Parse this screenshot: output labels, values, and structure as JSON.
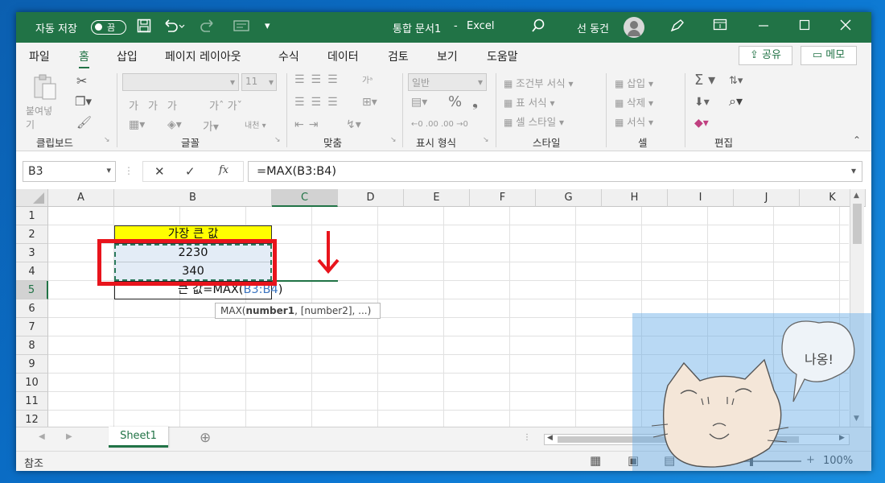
{
  "titlebar": {
    "autosave_label": "자동 저장",
    "toggle_state": "끔",
    "doc_title": "통합 문서1",
    "separator": "-",
    "app_name": "Excel",
    "user_name": "선 동건"
  },
  "menu": {
    "file": "파일",
    "home": "홈",
    "insert": "삽입",
    "page_layout": "페이지 레이아웃",
    "formulas": "수식",
    "data": "데이터",
    "review": "검토",
    "view": "보기",
    "help": "도움말",
    "share": "공유",
    "comments": "메모"
  },
  "ribbon": {
    "clipboard": "클립보드",
    "paste": "붙여넣기",
    "font": "글꼴",
    "font_size": "11",
    "alignment": "맞춤",
    "number": "표시 형식",
    "number_format": "일반",
    "styles": "스타일",
    "conditional_format": "조건부 서식",
    "format_as_table": "표 서식",
    "cell_styles": "셀 스타일",
    "cells": "셀",
    "insert": "삽입",
    "delete": "삭제",
    "format": "서식",
    "editing": "편집"
  },
  "formula_bar": {
    "name_box": "B3",
    "formula": "=MAX(B3:B4)"
  },
  "grid": {
    "columns": [
      "A",
      "B",
      "C",
      "D",
      "E",
      "F",
      "G",
      "H",
      "I",
      "J",
      "K"
    ],
    "rows": [
      "1",
      "2",
      "3",
      "4",
      "5",
      "6",
      "7",
      "8",
      "9",
      "10",
      "11",
      "12"
    ],
    "selected_column": "C",
    "selected_row": "5",
    "cells": {
      "B2": "가장 큰 값",
      "B3": "2230",
      "B4": "340",
      "B5_label": "큰 값",
      "B5_formula": "=MAX(",
      "B5_ref": "B3:B4",
      "B5_close": ")"
    },
    "highlight_fill": "#ffff00"
  },
  "tooltip": {
    "fn": "MAX(",
    "arg1": "number1",
    ",": ",",
    "rest": ", [number2], ...)"
  },
  "sheets": {
    "active": "Sheet1"
  },
  "status": {
    "mode": "참조",
    "zoom": "100%"
  },
  "overlay": {
    "speech": "나옹!"
  }
}
